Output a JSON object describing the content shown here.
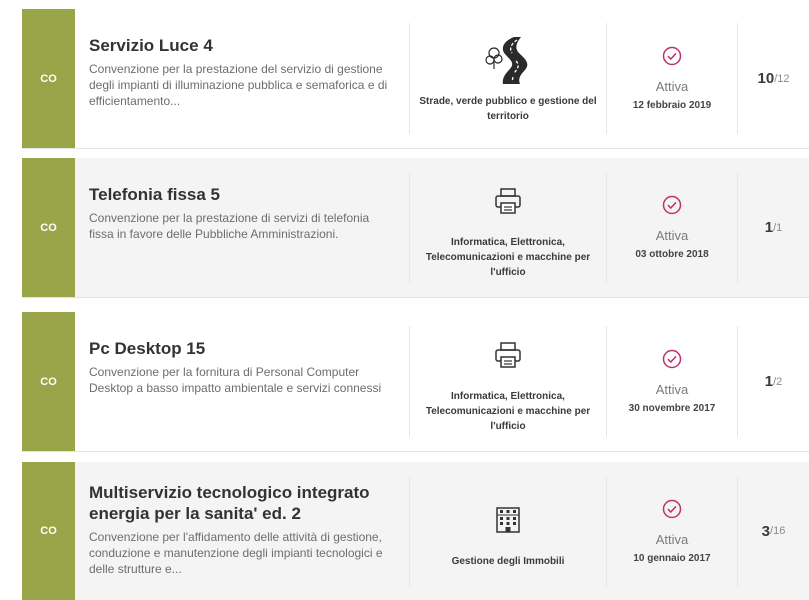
{
  "items": [
    {
      "badge": "CO",
      "title": "Servizio Luce 4",
      "description": "Convenzione per la prestazione del servizio di gestione degli impianti di illuminazione pubblica e semaforica e di efficientamento...",
      "category": "Strade, verde pubblico e gestione del territorio",
      "category_icon": "road-icon",
      "status": "Attiva",
      "date": "12 febbraio 2019",
      "count": "10",
      "count_total": "/12"
    },
    {
      "badge": "CO",
      "title": "Telefonia fissa 5",
      "description": "Convenzione per la prestazione di servizi di telefonia fissa in favore delle Pubbliche Amministrazioni.",
      "category": "Informatica, Elettronica, Telecomunicazioni e macchine per l'ufficio",
      "category_icon": "printer-icon",
      "status": "Attiva",
      "date": "03 ottobre 2018",
      "count": "1",
      "count_total": "/1"
    },
    {
      "badge": "CO",
      "title": "Pc Desktop 15",
      "description": "Convenzione per la fornitura di Personal Computer Desktop a basso impatto ambientale e servizi connessi",
      "category": "Informatica, Elettronica, Telecomunicazioni e macchine per l'ufficio",
      "category_icon": "printer-icon",
      "status": "Attiva",
      "date": "30 novembre 2017",
      "count": "1",
      "count_total": "/2"
    },
    {
      "badge": "CO",
      "title": "Multiservizio tecnologico integrato energia per la sanita' ed. 2",
      "description": "Convenzione per l'affidamento delle attività di gestione, conduzione e manutenzione degli impianti tecnologici e delle strutture e...",
      "category": "Gestione degli Immobili",
      "category_icon": "building-icon",
      "status": "Attiva",
      "date": "10 gennaio 2017",
      "count": "3",
      "count_total": "/16"
    }
  ],
  "colors": {
    "badge": "#9aa54a",
    "status_icon": "#c0306a"
  }
}
